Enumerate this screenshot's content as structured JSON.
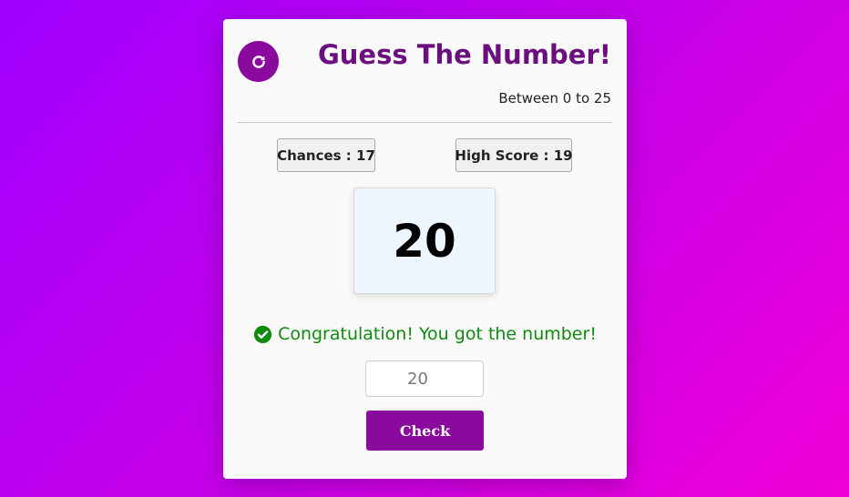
{
  "header": {
    "title": "Guess The Number!",
    "range_text": "Between 0 to 25",
    "reset_icon": "refresh-icon"
  },
  "stats": {
    "chances_label": "Chances : 17",
    "high_score_label": "High Score : 19"
  },
  "display": {
    "number": "20"
  },
  "message": {
    "text": "Congratulation! You got the number!",
    "icon": "check-circle-icon",
    "color": "#0f8a0f"
  },
  "guess": {
    "placeholder": "20"
  },
  "actions": {
    "check_label": "Check"
  },
  "colors": {
    "accent": "#8b0a9e",
    "title": "#6a0f7d",
    "background_start": "#a000ff",
    "background_end": "#f000d8"
  }
}
